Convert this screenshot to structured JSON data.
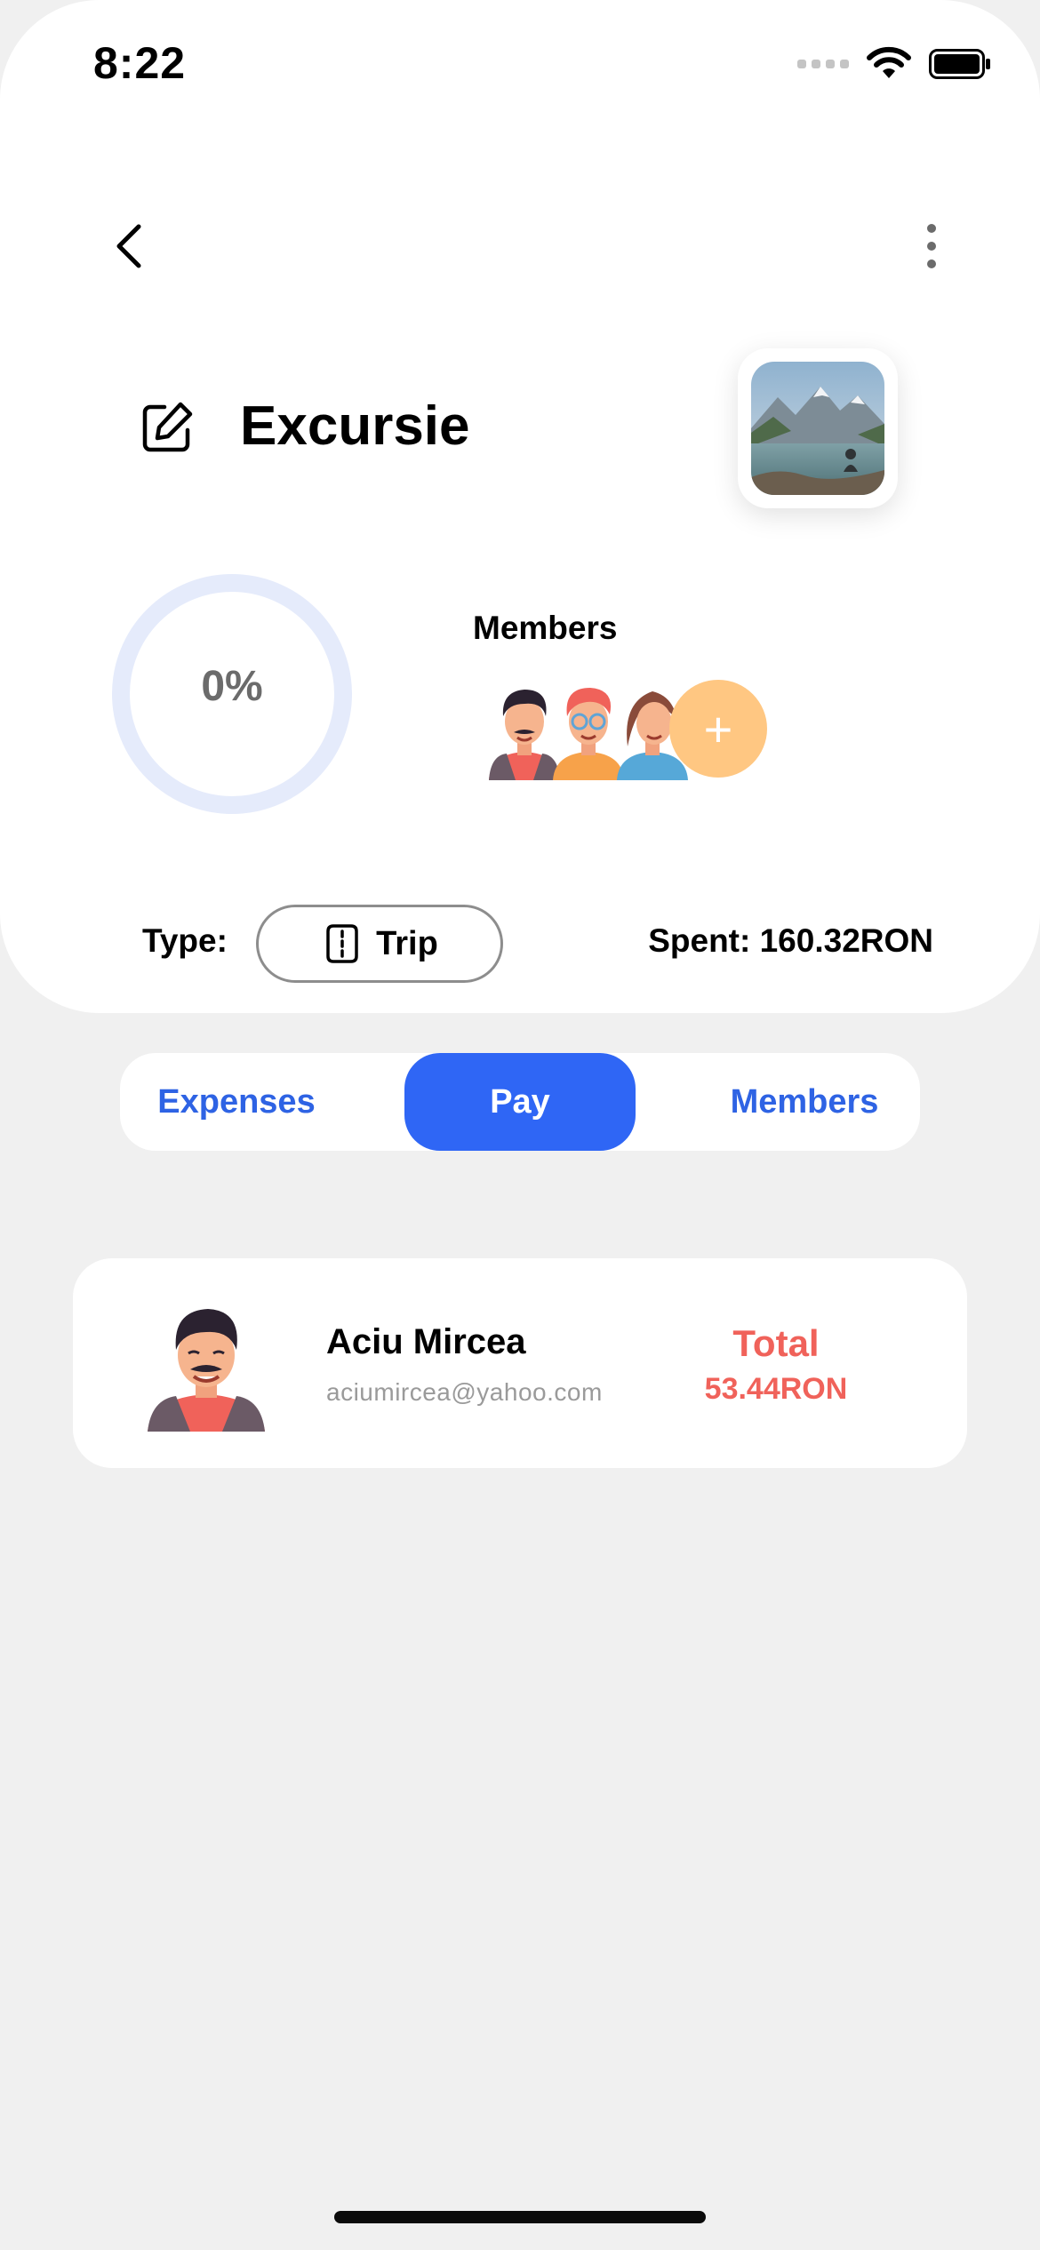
{
  "status_bar": {
    "time": "8:22"
  },
  "header": {
    "title": "Excursie"
  },
  "progress": {
    "value_text": "0%",
    "fraction": 0.0
  },
  "members_section": {
    "label": "Members",
    "add_symbol": "+"
  },
  "details": {
    "type_label": "Type:",
    "type_value": "Trip",
    "spent_text": "Spent: 160.32RON"
  },
  "tabs": [
    {
      "label": "Expenses",
      "active": false
    },
    {
      "label": "Pay",
      "active": true
    },
    {
      "label": "Members",
      "active": false
    }
  ],
  "pay_list": [
    {
      "name": "Aciu Mircea",
      "email": "aciumircea@yahoo.com",
      "total_label": "Total",
      "total_value": "53.44RON"
    }
  ],
  "colors": {
    "accent": "#2f66f5",
    "total": "#f0625a",
    "add_member": "#ffc782",
    "ring_track": "#e5ebfb"
  }
}
